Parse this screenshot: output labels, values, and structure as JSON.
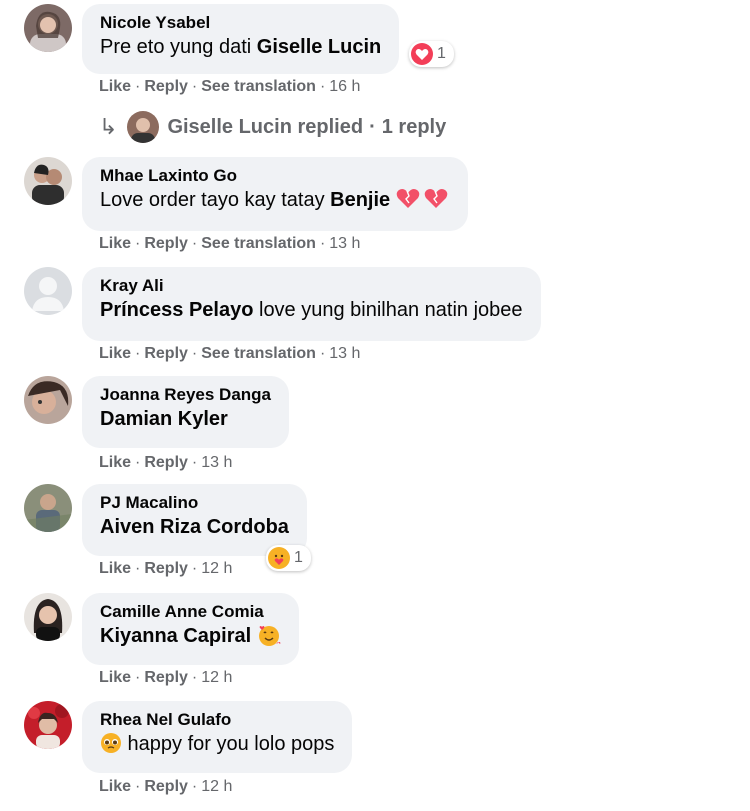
{
  "actions": {
    "like": "Like",
    "reply": "Reply",
    "see_translation": "See translation",
    "sep": "·"
  },
  "comments": [
    {
      "author": "Nicole Ysabel",
      "text": "Pre eto yung dati ",
      "mention": "Giselle Lucin",
      "reaction_count": "1",
      "time": "16 h",
      "replies": {
        "name": "Giselle Lucin replied",
        "count": "1 reply"
      }
    },
    {
      "author": "Mhae Laxinto Go",
      "text": "Love order tayo kay tatay ",
      "mention": "Benjie",
      "time": "13 h"
    },
    {
      "author": "Kray Ali",
      "mention": "Príncess Pelayo",
      "text": " love yung binilhan natin jobee",
      "time": "13 h"
    },
    {
      "author": "Joanna Reyes Danga",
      "mention": "Damian Kyler",
      "time": "13 h"
    },
    {
      "author": "PJ Macalino",
      "mention": "Aiven Riza Cordoba",
      "reaction_count": "1",
      "time": "12 h"
    },
    {
      "author": "Camille Anne Comia",
      "mention": "Kiyanna Capiral",
      "time": "12 h"
    },
    {
      "author": "Rhea Nel Gulafo",
      "text": " happy for you lolo pops",
      "time": "12 h"
    }
  ],
  "colors": {
    "bubble": "#f0f2f5",
    "meta": "#65676b",
    "text": "#050505",
    "heart": "#f33e58"
  },
  "icons": [
    "reply-arrow-icon",
    "love-reaction-icon",
    "care-reaction-icon",
    "hearts-emoji-icon",
    "smiling-hearts-emoji-icon",
    "pleading-emoji-icon"
  ]
}
